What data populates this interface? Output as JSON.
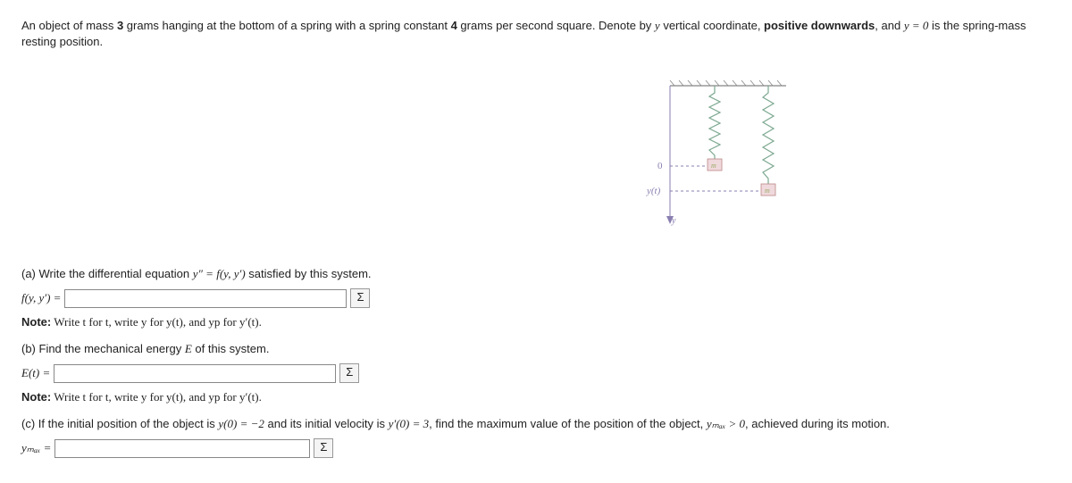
{
  "intro": {
    "pre": "An object of mass ",
    "mass": "3",
    "mid1": " grams hanging at the bottom of a spring with a spring constant ",
    "spring_k": "4",
    "mid2": " grams per second square. Denote by ",
    "var_y": "y",
    "mid3": " vertical coordinate, ",
    "bold": "positive downwards",
    "mid4": ", and ",
    "eqn": "y = 0",
    "tail": " is the spring-mass resting position."
  },
  "figure": {
    "origin_label": "0",
    "yt_label": "y(t)",
    "y_arrow_label": "y",
    "mass_label": "m"
  },
  "part_a": {
    "prompt_pre": "(a) Write the differential equation ",
    "prompt_eq": "y″ = f(y, y′)",
    "prompt_post": " satisfied by this system.",
    "lhs": "f(y, y′) =",
    "note_pre": "Note:",
    "note_body": " Write t for t, write y for y(t), and yp for y′(t)."
  },
  "part_b": {
    "prompt_pre": "(b) Find the mechanical energy ",
    "prompt_var": "E",
    "prompt_post": " of this system.",
    "lhs": "E(t) =",
    "note_pre": "Note:",
    "note_body": " Write t for t, write y for y(t), and yp for y′(t)."
  },
  "part_c": {
    "pre": "(c) If the initial position of the object is ",
    "y0": "y(0) = −2",
    "mid1": " and its initial velocity is ",
    "yp0": "y′(0) = 3",
    "mid2": ", find the maximum value of the position of the object, ",
    "ymax_cond": "yₘₐₓ > 0",
    "tail": ", achieved during its motion.",
    "lhs": "yₘₐₓ ="
  },
  "sigma": "Σ"
}
